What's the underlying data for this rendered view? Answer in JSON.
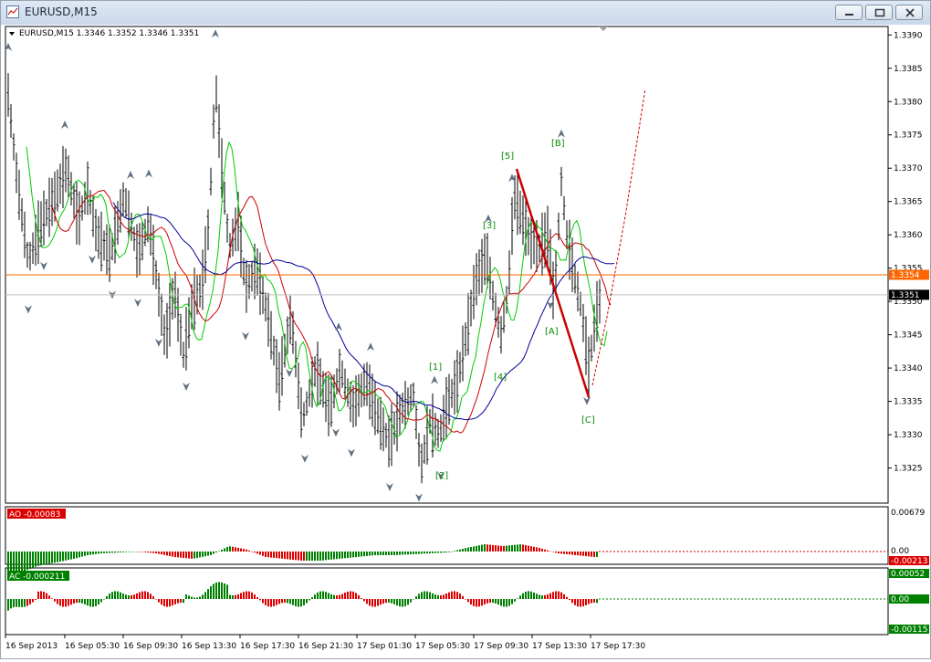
{
  "window": {
    "title": "EURUSD,M15"
  },
  "chart": {
    "symbol_line": "EURUSD,M15  1.3346 1.3352 1.3346 1.3351",
    "price_axis": [
      "1.3390",
      "1.3385",
      "1.3380",
      "1.3375",
      "1.3370",
      "1.3365",
      "1.3360",
      "1.3355",
      "1.3350",
      "1.3345",
      "1.3340",
      "1.3335",
      "1.3330",
      "1.3325"
    ],
    "price_range": [
      1.332,
      1.3391
    ],
    "hline_price": 1.3354,
    "hline_label": "1.3354",
    "hline_color": "#ff6600",
    "bid_price": 1.3351,
    "bid_label": "1.3351",
    "time_axis": [
      "16 Sep 2013",
      "16 Sep 05:30",
      "16 Sep 09:30",
      "16 Sep 13:30",
      "16 Sep 17:30",
      "16 Sep 21:30",
      "17 Sep 01:30",
      "17 Sep 05:30",
      "17 Sep 09:30",
      "17 Sep 13:30",
      "17 Sep 17:30"
    ],
    "wave_labels": [
      "[1]",
      "[2]",
      "[3]",
      "[4]",
      "[5]",
      "[A]",
      "[B]",
      "[C]"
    ],
    "ma_colors": {
      "fast": "#00cc00",
      "mid": "#cc0000",
      "slow": "#000099"
    }
  },
  "ao": {
    "label": "AO -0.00083",
    "axis_top": "0.00679",
    "axis_zero": "0.00",
    "axis_bottom": "-0.00213",
    "up_color": "#008000",
    "down_color": "#dd0000"
  },
  "ac": {
    "label": "AC -0.000211",
    "axis_top": "0.00052",
    "axis_zero": "0.00",
    "axis_bottom": "-0.00115",
    "up_color": "#008000",
    "down_color": "#dd0000"
  }
}
